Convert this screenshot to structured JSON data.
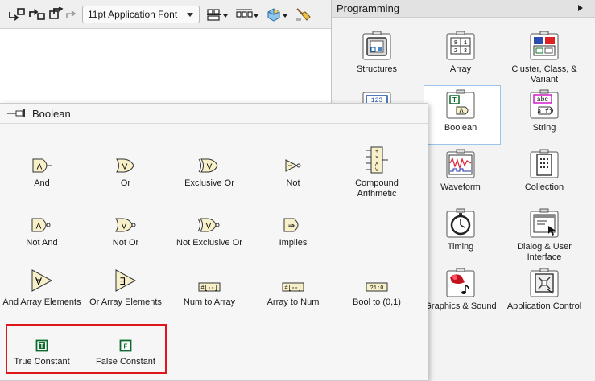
{
  "toolbar": {
    "font_select_value": "11pt Application Font"
  },
  "programming": {
    "title": "Programming",
    "items": [
      {
        "label": "Structures"
      },
      {
        "label": "Array"
      },
      {
        "label": "Cluster, Class, & Variant"
      },
      {
        "label": "Boolean"
      },
      {
        "label": "String"
      },
      {
        "label": "Waveform"
      },
      {
        "label": "Collection"
      },
      {
        "label": "Timing"
      },
      {
        "label": "Dialog & User Interface"
      },
      {
        "label": "Graphics & Sound"
      },
      {
        "label": "Application Control"
      }
    ]
  },
  "boolean_palette": {
    "title": "Boolean",
    "items": [
      {
        "label": "And"
      },
      {
        "label": "Or"
      },
      {
        "label": "Exclusive Or"
      },
      {
        "label": "Not"
      },
      {
        "label": "Compound Arithmetic"
      },
      {
        "label": "Not And"
      },
      {
        "label": "Not Or"
      },
      {
        "label": "Not Exclusive Or"
      },
      {
        "label": "Implies"
      },
      {
        "label": "And Array Elements"
      },
      {
        "label": "Or Array Elements"
      },
      {
        "label": "Num to Array"
      },
      {
        "label": "Array to Num"
      },
      {
        "label": "Bool to (0,1)"
      },
      {
        "label": "True Constant"
      },
      {
        "label": "False Constant"
      }
    ],
    "glyphs": {
      "true_constant": "T",
      "false_constant": "F",
      "bool_to_01": "?1:0",
      "array_to_num": "#[▫▫]",
      "num_to_array": "#[▫▫]"
    }
  },
  "icon_glyphs": {
    "array_cells": [
      "8",
      "1",
      "2",
      "3"
    ],
    "numeric_sample": "123",
    "string_sample": "abc",
    "string_sample_2": "a fi",
    "boolean_t": "T"
  },
  "colors": {
    "gate_fill": "#f7f0c9",
    "constant_green": "#0d6b2e",
    "highlight_red": "#e0161d",
    "selection_blue": "#9cc4ea"
  }
}
